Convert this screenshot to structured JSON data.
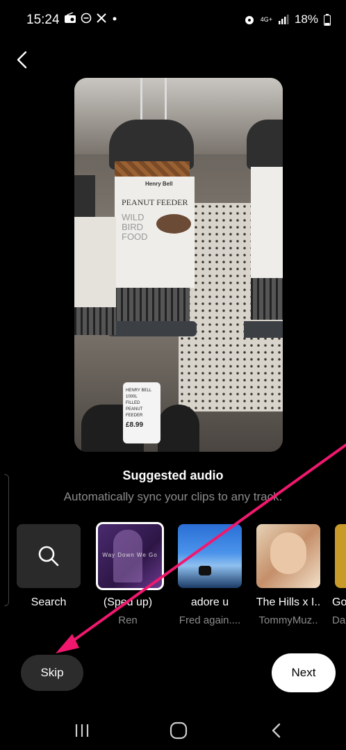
{
  "status_bar": {
    "time": "15:24",
    "left_icons": [
      "radio-icon",
      "minus-circle-icon",
      "x-logo-icon",
      "dot-icon"
    ],
    "network": "4G+",
    "battery": "18%"
  },
  "preview": {
    "label_title": "PEANUT FEEDER",
    "label_brand": "Henry Bell",
    "label_sub": "WILD BIRD FOOD",
    "price_tag_lines": [
      "HENRY BELL 1000L",
      "FILLED PEANUT",
      "FEEDER",
      "£8.99"
    ]
  },
  "suggested": {
    "title": "Suggested audio",
    "subtitle": "Automatically sync your clips to any track."
  },
  "tracks": [
    {
      "name": "Search",
      "artist": ""
    },
    {
      "name": "(Sped up)",
      "artist": "Ren",
      "cover_text": "Way Down We Go"
    },
    {
      "name": "adore u",
      "artist": "Fred again...."
    },
    {
      "name": "The Hills x I..",
      "artist": "TommyMuz.."
    },
    {
      "name": "Go",
      "artist": "Da"
    }
  ],
  "buttons": {
    "skip": "Skip",
    "next": "Next"
  },
  "colors": {
    "accent_arrow": "#f0186e",
    "selected_border": "#ffffff"
  }
}
